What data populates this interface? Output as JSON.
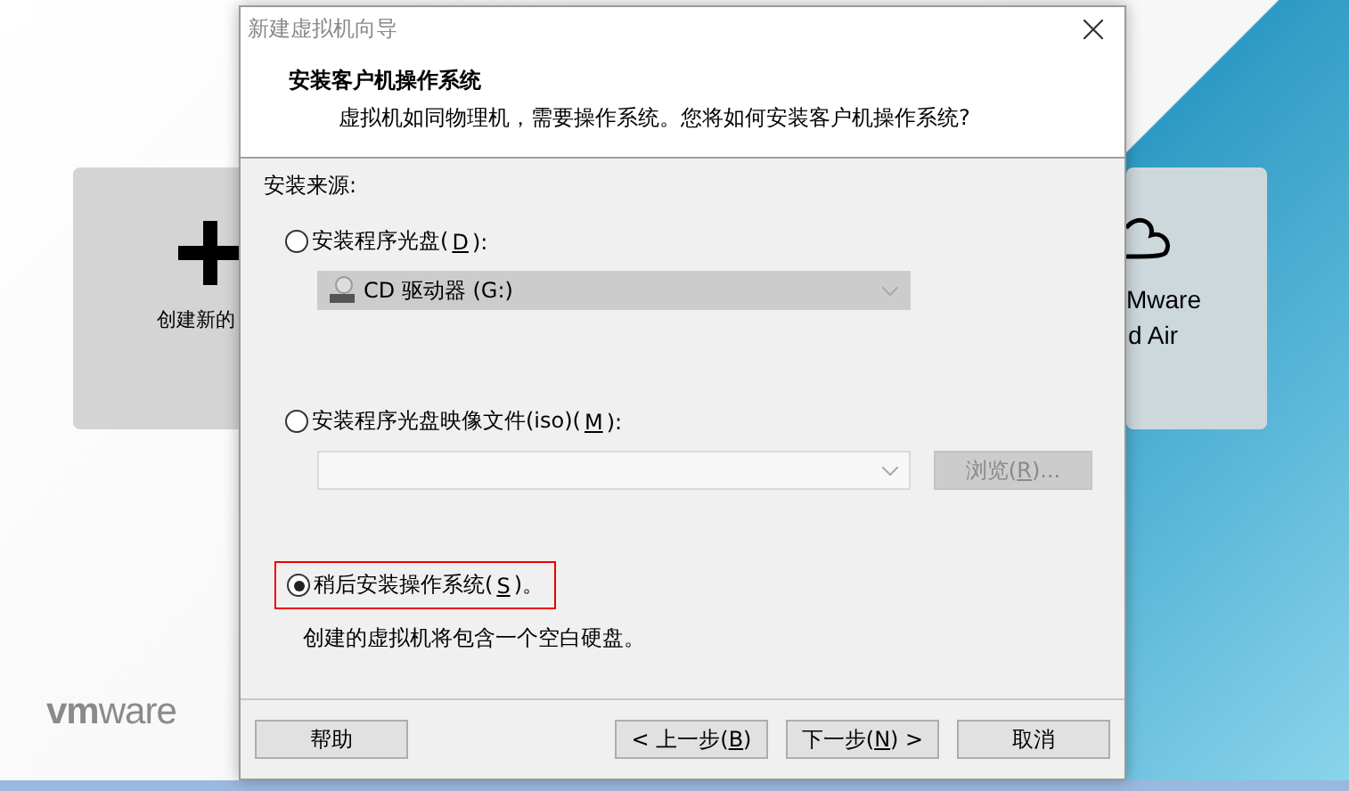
{
  "home": {
    "tiles": [
      {
        "kind": "create",
        "label": "创建新的"
      },
      {
        "kind": "cloud",
        "label_lines": [
          "Mware",
          "d Air"
        ]
      }
    ],
    "logo": {
      "bold": "vm",
      "rest": "ware"
    }
  },
  "dialog": {
    "title": "新建虚拟机向导",
    "heading": "安装客户机操作系统",
    "subheading": "虚拟机如同物理机，需要操作系统。您将如何安装客户机操作系统?",
    "source_label": "安装来源:",
    "options": [
      {
        "kind": "disc",
        "label": "安装程序光盘(",
        "key": "D",
        "suffix": "):",
        "selected": false,
        "highlighted": false,
        "combo": {
          "value": "CD 驱动器 (G:)",
          "disabled": true
        }
      },
      {
        "kind": "iso",
        "label": "安装程序光盘映像文件(iso)(",
        "key": "M",
        "suffix": "):",
        "selected": false,
        "highlighted": false,
        "combo": {
          "disabled": true
        },
        "browse": {
          "label": "浏览(",
          "key": "R",
          "suffix": ")...",
          "disabled": true
        }
      },
      {
        "kind": "later",
        "label": "稍后安装操作系统(",
        "key": "S",
        "suffix": ")。",
        "selected": true,
        "highlighted": true,
        "note": "创建的虚拟机将包含一个空白硬盘。"
      }
    ],
    "buttons": [
      {
        "kind": "help",
        "label": "帮助"
      },
      {
        "kind": "nav",
        "label": "< 上一步(",
        "key": "B",
        "suffix": ")"
      },
      {
        "kind": "nav",
        "label": "下一步(",
        "key": "N",
        "suffix": ") >"
      },
      {
        "kind": "nav",
        "label": "取消"
      }
    ]
  }
}
